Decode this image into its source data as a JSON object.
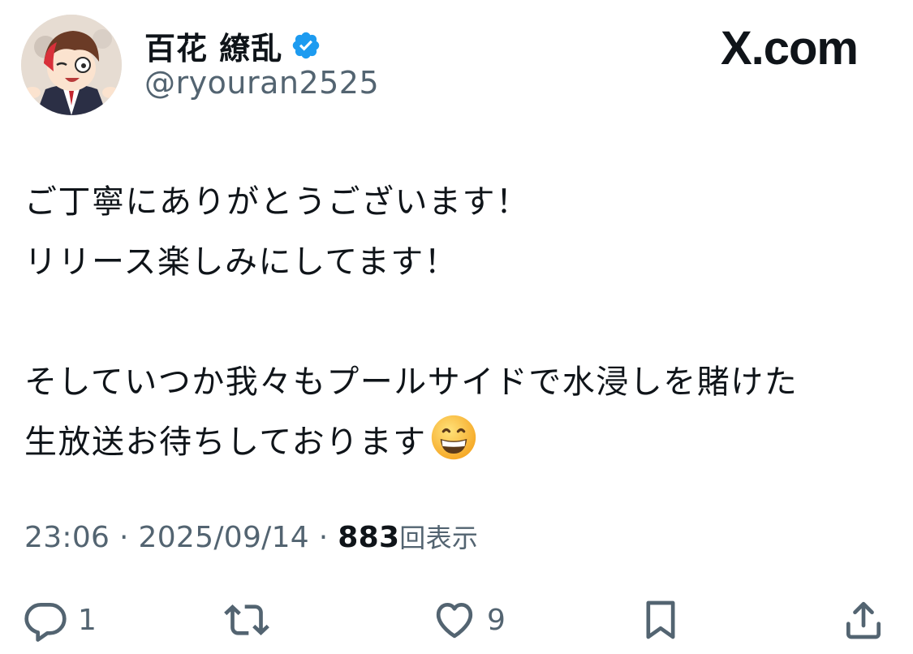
{
  "user": {
    "display_name": "百花 繚乱",
    "handle": "@ryouran2525",
    "verified": true,
    "verified_color": "#1d9bf0"
  },
  "brand": "X.com",
  "tweet": {
    "lines": [
      "ご丁寧にありがとうございます！",
      "リリース楽しみにしてます！",
      "",
      "そしていつか我々もプールサイドで水浸しを賭けた",
      "生放送お待ちしております"
    ],
    "trailing_emoji": "grinning-face-with-smiling-eyes"
  },
  "meta": {
    "time": "23:06",
    "separator": "·",
    "date": "2025/09/14",
    "views_count": "883",
    "views_label": "回表示"
  },
  "actions": {
    "reply_count": "1",
    "retweet_count": "",
    "like_count": "9"
  },
  "colors": {
    "text": "#0f1419",
    "secondary": "#536471",
    "accent": "#1d9bf0"
  }
}
